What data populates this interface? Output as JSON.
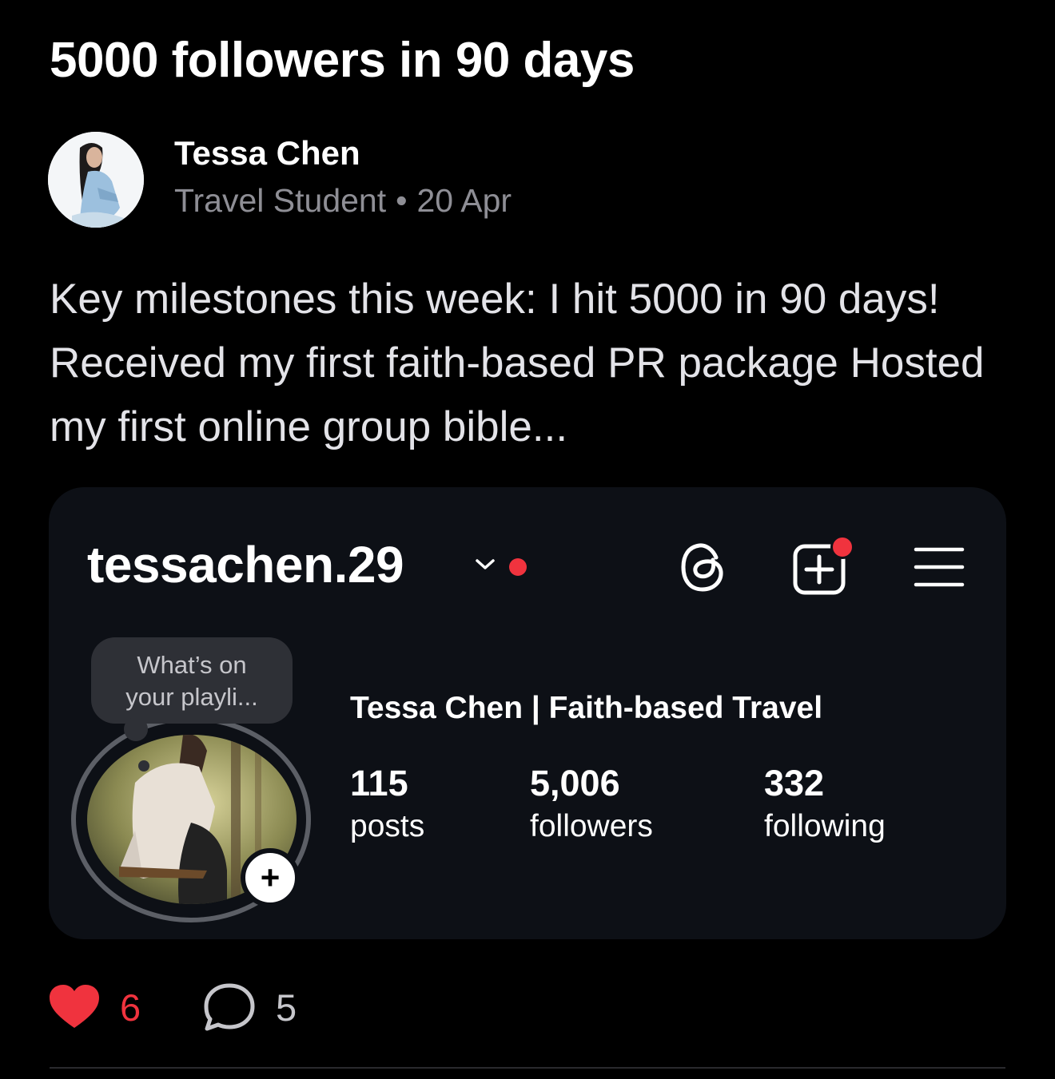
{
  "post": {
    "title": "5000 followers in 90 days",
    "author_name": "Tessa Chen",
    "author_role": "Travel Student",
    "date": "20 Apr",
    "body": "Key milestones this week: I hit 5000 in 90 days! Received my first faith-based PR package Hosted my first online group bible..."
  },
  "embed": {
    "username": "tessachen.29",
    "note_line1": "What’s on",
    "note_line2": "your playli...",
    "full_name": "Tessa Chen | Faith-based Travel",
    "stats": [
      {
        "value": "115",
        "label": "posts"
      },
      {
        "value": "5,006",
        "label": "followers"
      },
      {
        "value": "332",
        "label": "following"
      }
    ],
    "add_story_symbol": "+",
    "icons": [
      "chevron-down-icon",
      "threads-icon",
      "new-post-icon",
      "menu-icon"
    ],
    "notification_color": "#f0333e"
  },
  "actions": {
    "likes": "6",
    "comments": "5"
  },
  "colors": {
    "background": "#000000",
    "card": "#0d1016",
    "accent_red": "#f0333e",
    "muted_text": "#8e8e95"
  }
}
